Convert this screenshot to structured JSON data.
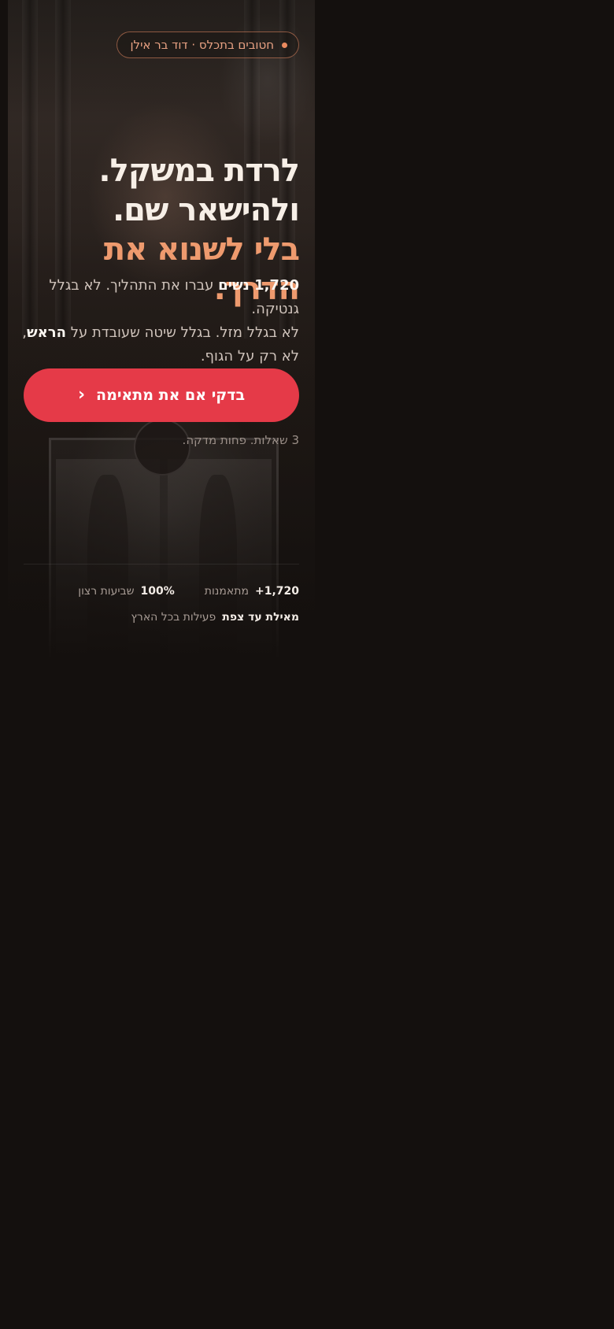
{
  "badge": {
    "text": "חטובים בתכלס · דוד בר אילן",
    "accent": "#e98a5f"
  },
  "headline": {
    "line1": "לרדת במשקל.",
    "line2": "ולהישאר שם.",
    "line3": "בלי לשנוא את הדרך."
  },
  "subtitle": {
    "count": "1,720 נשים",
    "part1": " עברו את התהליך. לא בגלל גנטיקה.",
    "part2": "לא בגלל מזל. בגלל שיטה שעובדת על ",
    "head": "הראש",
    "part3": ",",
    "part4": "לא רק על הגוף."
  },
  "cta": {
    "label": "בדקי אם את מתאימה",
    "icon": "chevron-left-icon",
    "color": "#e53a48"
  },
  "note": "3 שאלות. פחות מדקה.",
  "stats": [
    {
      "value": "1,720+",
      "label": "מתאמנות"
    },
    {
      "value": "100%",
      "label": "שביעות רצון"
    }
  ],
  "coverage": {
    "value": "מאילת עד צפת",
    "label": "פעילות בכל הארץ"
  }
}
